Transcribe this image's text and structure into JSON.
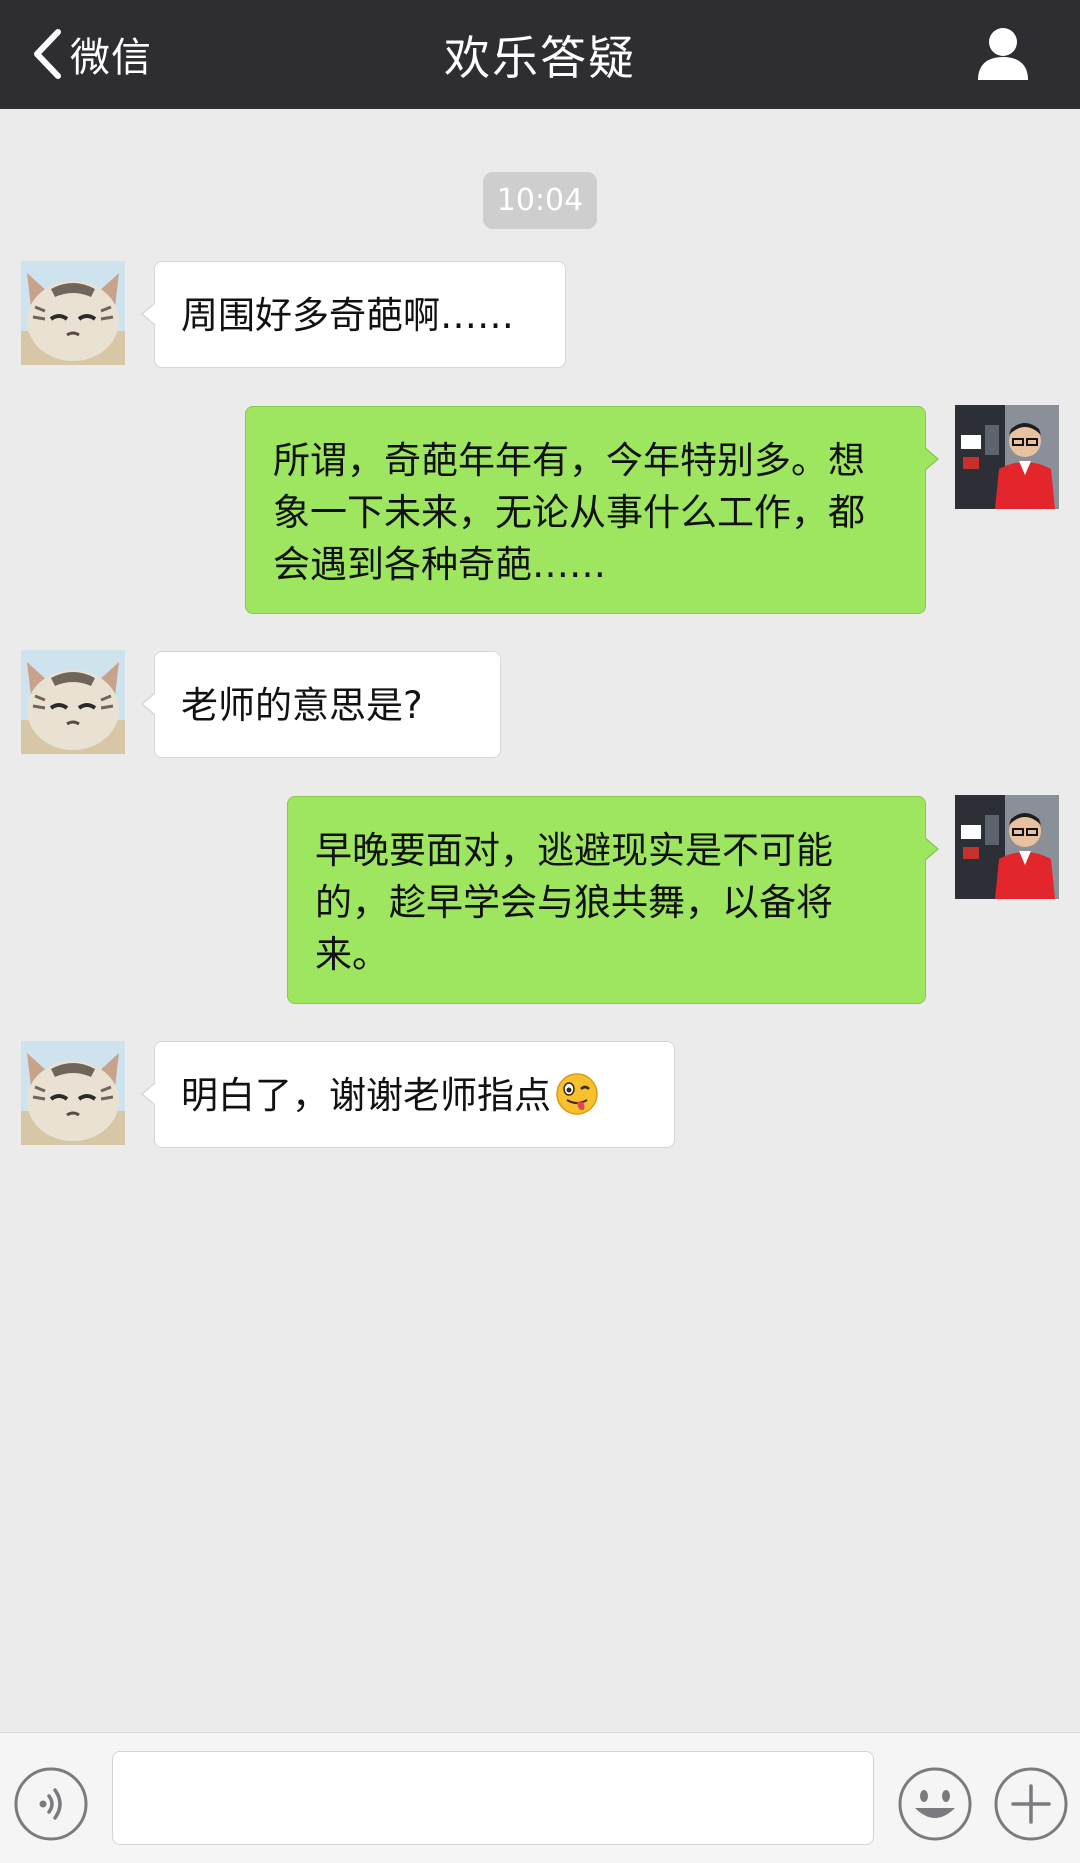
{
  "header": {
    "back_label": "微信",
    "title": "欢乐答疑"
  },
  "chat": {
    "timestamp": "10:04",
    "messages": [
      {
        "side": "in",
        "text": "周围好多奇葩啊……"
      },
      {
        "side": "out",
        "text": "所谓，奇葩年年有，今年特别多。想象一下未来，无论从事什么工作，都会遇到各种奇葩……"
      },
      {
        "side": "in",
        "text": "老师的意思是?"
      },
      {
        "side": "out",
        "text": "早晚要面对，逃避现实是不可能的，趁早学会与狼共舞，以备将来。"
      },
      {
        "side": "in",
        "text": "明白了，谢谢老师指点",
        "emoji": "winking-tongue-emoji"
      }
    ]
  },
  "input_bar": {
    "text_value": "",
    "icons": [
      "voice-icon",
      "emoji-face-icon",
      "plus-icon"
    ]
  },
  "colors": {
    "header_bg": "#2e2d32",
    "chat_bg": "#ebebeb",
    "outgoing_bubble": "#9ee65f",
    "incoming_bubble": "#ffffff"
  }
}
